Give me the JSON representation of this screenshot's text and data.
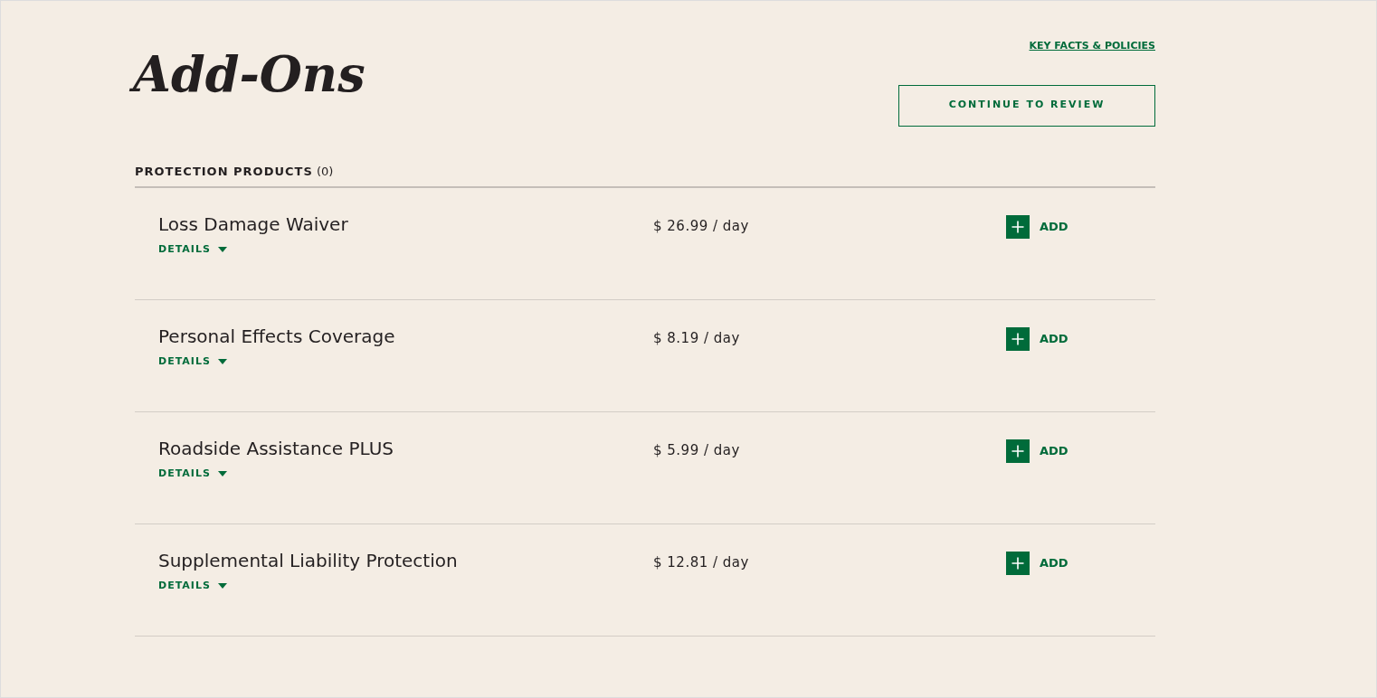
{
  "page": {
    "title": "Add-Ons",
    "policies_link": "KEY FACTS & POLICIES",
    "continue_button": "CONTINUE TO REVIEW"
  },
  "section": {
    "label": "PROTECTION PRODUCTS",
    "count": "(0)"
  },
  "products": [
    {
      "name": "Loss Damage Waiver",
      "details": "DETAILS",
      "price": "$ 26.99 / day",
      "add": "ADD"
    },
    {
      "name": "Personal Effects Coverage",
      "details": "DETAILS",
      "price": "$ 8.19 / day",
      "add": "ADD"
    },
    {
      "name": "Roadside Assistance PLUS",
      "details": "DETAILS",
      "price": "$ 5.99 / day",
      "add": "ADD"
    },
    {
      "name": "Supplemental Liability Protection",
      "details": "DETAILS",
      "price": "$ 12.81 / day",
      "add": "ADD"
    }
  ]
}
